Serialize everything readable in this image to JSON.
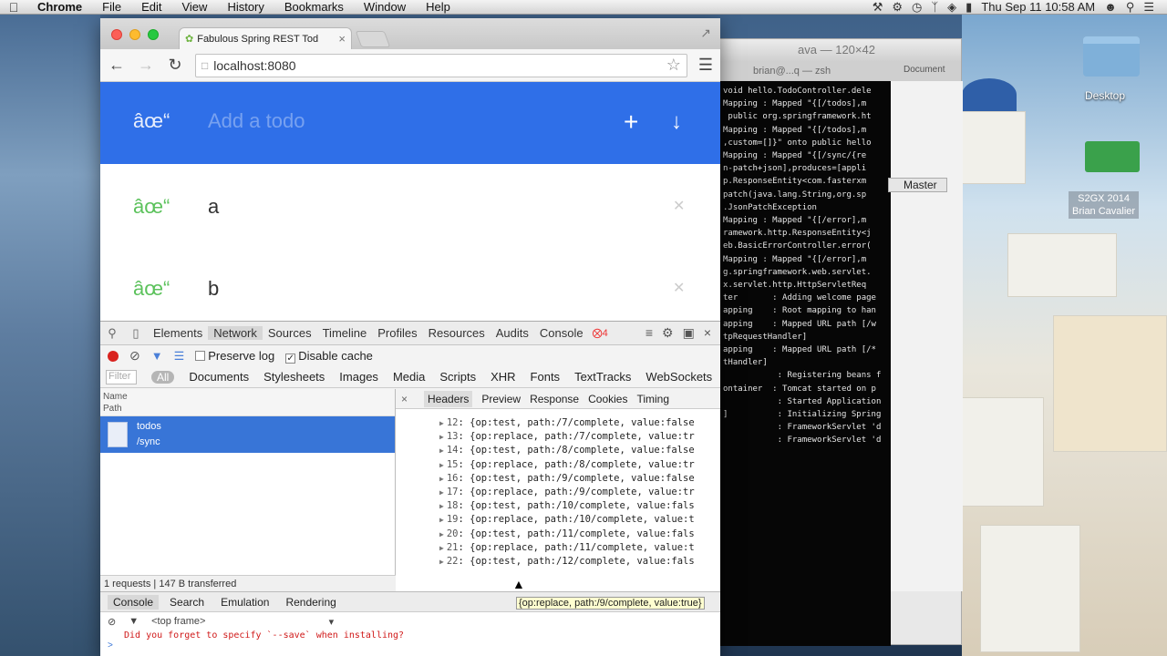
{
  "menubar": {
    "apple_icon": "apple-icon",
    "app": "Chrome",
    "items": [
      "File",
      "Edit",
      "View",
      "History",
      "Bookmarks",
      "Window",
      "Help"
    ],
    "clock": "Thu Sep 11  10:58 AM"
  },
  "desktop": {
    "folder_label": "Desktop",
    "badge_line1": "S2GX 2014",
    "badge_line2": "Brian Cavalier"
  },
  "terminal": {
    "title": "ava — 120×42",
    "tab": "brian@...q — zsh",
    "document": "Document",
    "master": "Master",
    "lines": [
      "void hello.TodoController.dele",
      "",
      "Mapping : Mapped \"{[/todos],m",
      " public org.springframework.ht",
      "",
      "Mapping : Mapped \"{[/todos],m",
      ",custom=[]}\" onto public hello",
      "",
      "Mapping : Mapped \"{[/sync/{re",
      "n-patch+json],produces=[appli",
      "p.ResponseEntity<com.fasterxm",
      "patch(java.lang.String,org.sp",
      ".JsonPatchException",
      "Mapping : Mapped \"{[/error],m",
      "ramework.http.ResponseEntity<j",
      "eb.BasicErrorController.error(",
      "",
      "Mapping : Mapped \"{[/error],m",
      "g.springframework.web.servlet.",
      "x.servlet.http.HttpServletReq",
      "",
      "ter       : Adding welcome page",
      "",
      "apping    : Root mapping to han",
      "",
      "apping    : Mapped URL path [/w",
      "tpRequestHandler]",
      "apping    : Mapped URL path [/*",
      "tHandler]",
      "",
      "           : Registering beans f",
      "",
      "ontainer  : Tomcat started on p",
      "",
      "           : Started Application",
      "",
      "]          : Initializing Spring",
      "",
      "           : FrameworkServlet 'd",
      "",
      "           : FrameworkServlet 'd"
    ]
  },
  "chrome": {
    "tab_title": "Fabulous Spring REST Tod",
    "url": "localhost:8080"
  },
  "app": {
    "toggle_glyph": "âœ“",
    "placeholder": "Add a todo",
    "plus": "+",
    "down": "↓",
    "todos": [
      {
        "glyph": "âœ“",
        "text": "a"
      },
      {
        "glyph": "âœ“",
        "text": "b"
      }
    ]
  },
  "devtools": {
    "tabs": [
      "Elements",
      "Network",
      "Sources",
      "Timeline",
      "Profiles",
      "Resources",
      "Audits",
      "Console"
    ],
    "active_tab": "Network",
    "error_count": "4",
    "preserve_log": "Preserve log",
    "disable_cache": "Disable cache",
    "filter_placeholder": "Filter",
    "filters": [
      "All",
      "Documents",
      "Stylesheets",
      "Images",
      "Media",
      "Scripts",
      "XHR",
      "Fonts",
      "TextTracks",
      "WebSockets"
    ],
    "list_header_name": "Name",
    "list_header_path": "Path",
    "request_name": "todos",
    "request_path": "/sync",
    "status_text": "1 requests | 147 B transferred",
    "detail_tabs": [
      "Headers",
      "Preview",
      "Response",
      "Cookies",
      "Timing"
    ],
    "detail_lines": [
      {
        "n": "12",
        "t": "{op:test, path:/7/complete, value:false"
      },
      {
        "n": "13",
        "t": "{op:replace, path:/7/complete, value:tr"
      },
      {
        "n": "14",
        "t": "{op:test, path:/8/complete, value:false"
      },
      {
        "n": "15",
        "t": "{op:replace, path:/8/complete, value:tr"
      },
      {
        "n": "16",
        "t": "{op:test, path:/9/complete, value:false"
      },
      {
        "n": "17",
        "t": "{op:replace, path:/9/complete, value:tr"
      },
      {
        "n": "18",
        "t": "{op:test, path:/10/complete, value:fals"
      },
      {
        "n": "19",
        "t": "{op:replace, path:/10/complete, value:t"
      },
      {
        "n": "20",
        "t": "{op:test, path:/11/complete, value:fals"
      },
      {
        "n": "21",
        "t": "{op:replace, path:/11/complete, value:t"
      },
      {
        "n": "22",
        "t": "{op:test, path:/12/complete, value:fals"
      }
    ],
    "tooltip": "{op:replace, path:/9/complete, value:true}",
    "drawer_tabs": [
      "Console",
      "Search",
      "Emulation",
      "Rendering"
    ],
    "frame_select": "<top frame>",
    "console_error": "Did you forget to specify `--save` when installing?",
    "prompt": ">"
  }
}
